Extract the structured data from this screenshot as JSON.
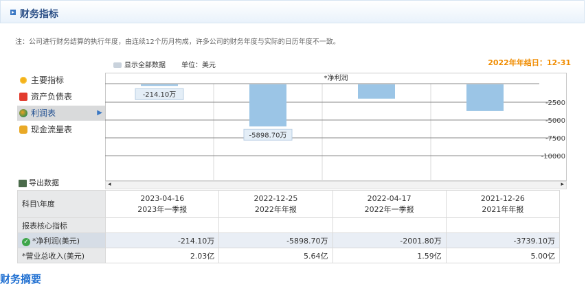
{
  "panel": {
    "title": "财务指标"
  },
  "notice": "注：公司进行财务结算的执行年度，由连续12个历月构成，许多公司的财务年度与实际的日历年度不一致。",
  "year_end": "2022年年结日：12-31",
  "show_all_label": "显示全部数据",
  "unit_label": "单位：美元",
  "menu": [
    {
      "label": "主要指标",
      "icon": "sun-icon"
    },
    {
      "label": "资产负债表",
      "icon": "book-icon"
    },
    {
      "label": "利润表",
      "icon": "ball-icon",
      "active": true
    },
    {
      "label": "现金流量表",
      "icon": "coins-icon"
    }
  ],
  "export_label": "导出数据",
  "chart_data": {
    "type": "bar",
    "title": "*净利润",
    "categories": [
      "2023-04-16",
      "2022-12-25",
      "2022-04-17",
      "2021-12-26"
    ],
    "values": [
      -214.1,
      -5898.7,
      -2001.8,
      -3739.1
    ],
    "ylim": [
      -12000,
      1000
    ],
    "yticks": [
      -2500,
      -5000,
      -7500,
      -10000
    ],
    "data_labels": [
      "-214.10万",
      "-5898.70万"
    ],
    "grid": true
  },
  "table": {
    "header_label": "科目\\年度",
    "columns": [
      {
        "date": "2023-04-16",
        "report": "2023年一季报"
      },
      {
        "date": "2022-12-25",
        "report": "2022年年报"
      },
      {
        "date": "2022-04-17",
        "report": "2022年一季报"
      },
      {
        "date": "2021-12-26",
        "report": "2021年年报"
      }
    ],
    "section_label": "报表核心指标",
    "rows": [
      {
        "label": "*净利润(美元)",
        "values": [
          "-214.10万",
          "-5898.70万",
          "-2001.80万",
          "-3739.10万"
        ]
      },
      {
        "label": "*营业总收入(美元)",
        "values": [
          "2.03亿",
          "5.64亿",
          "1.59亿",
          "5.00亿"
        ]
      }
    ]
  },
  "bottom_text": "财务摘要"
}
